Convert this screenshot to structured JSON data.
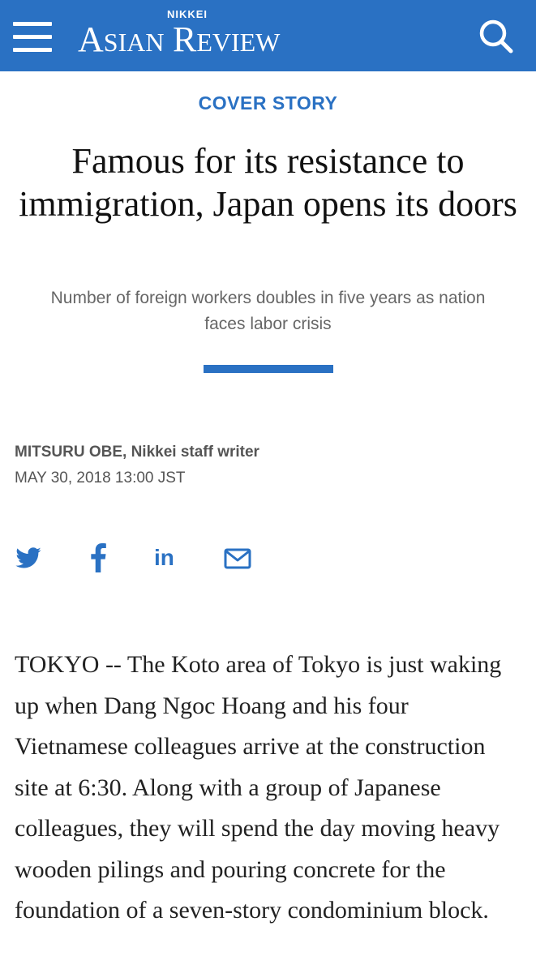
{
  "header": {
    "menu_icon": "hamburger-menu-icon",
    "logo_small": "NIKKEI",
    "logo_big_a": "A",
    "logo_big_sian": "SIAN",
    "logo_big_r": "R",
    "logo_big_eview": "EVIEW",
    "search_icon": "search-icon",
    "bar_color": "#2a71c3"
  },
  "article": {
    "kicker": "COVER STORY",
    "headline": "Famous for its resistance to immigration, Japan opens its doors",
    "subhead": "Number of foreign workers doubles in five years as nation faces labor crisis",
    "author": "MITSURU OBE",
    "author_role": "Nikkei staff writer",
    "date": "MAY 30, 2018 13:00 JST",
    "body": "TOKYO -- The Koto area of Tokyo is just waking up when Dang Ngoc Hoang and his four Vietnamese colleagues arrive at the construction site at 6:30. Along with a group of Japanese colleagues, they will spend the day moving heavy wooden pilings and pouring concrete for the foundation of a seven-story condominium block."
  },
  "share": {
    "twitter_icon": "twitter-icon",
    "facebook_icon": "facebook-icon",
    "linkedin_label": "in",
    "mail_icon": "mail-icon",
    "accent_color": "#2a71c3"
  }
}
